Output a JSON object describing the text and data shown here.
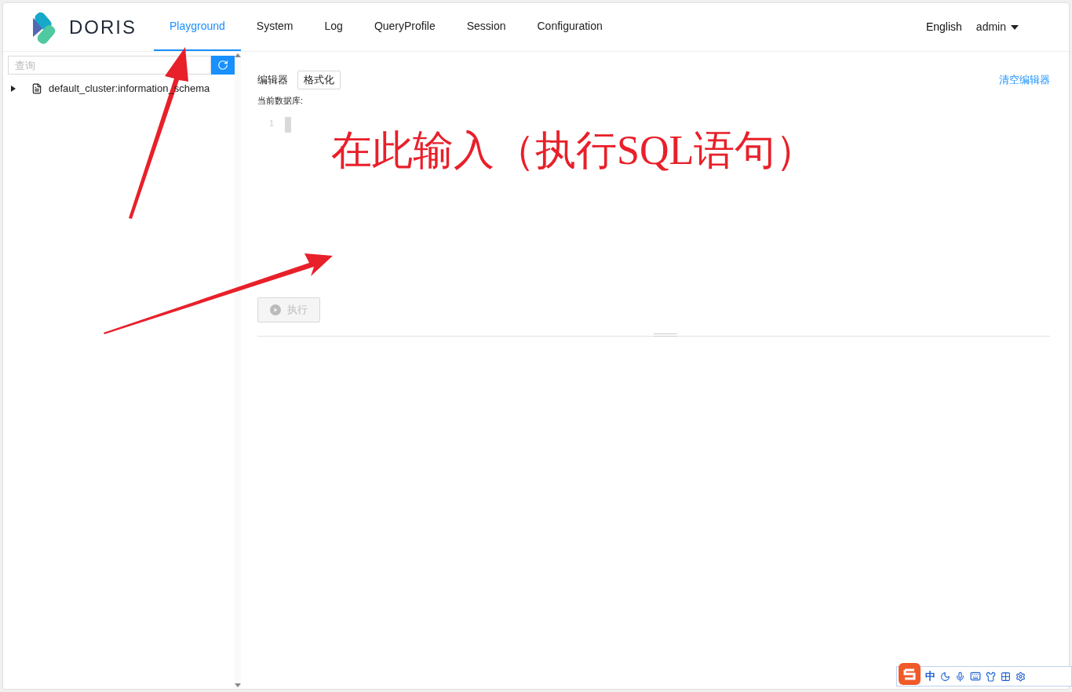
{
  "brand": "DORIS",
  "nav": [
    {
      "label": "Playground",
      "selected": true
    },
    {
      "label": "System",
      "selected": false
    },
    {
      "label": "Log",
      "selected": false
    },
    {
      "label": "QueryProfile",
      "selected": false
    },
    {
      "label": "Session",
      "selected": false
    },
    {
      "label": "Configuration",
      "selected": false
    }
  ],
  "language": {
    "label": "English",
    "selected": true
  },
  "user": "admin",
  "sidebar": {
    "search": {
      "placeholder": "查询"
    },
    "tree": [
      {
        "label": "default_cluster:information_schema",
        "expanded": false
      }
    ]
  },
  "editor": {
    "label": "编辑器",
    "format_button": "格式化",
    "clear_link": "清空编辑器",
    "current_db_label": "当前数据库:",
    "line_numbers": [
      "1"
    ],
    "run_button": {
      "label": "执行",
      "disabled": true
    }
  },
  "annotation": {
    "text": "在此输入（执行SQL语句）"
  },
  "ime_toolbar": {
    "mode": "中"
  }
}
